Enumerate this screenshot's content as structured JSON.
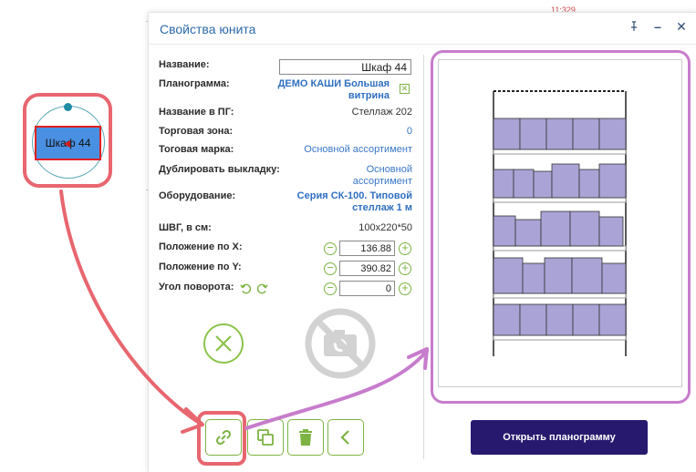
{
  "background": {
    "timestamp": "11:329"
  },
  "canvas_unit": {
    "label": "Шкаф 44"
  },
  "dialog": {
    "title": "Свойства юнита",
    "controls": {
      "pin": "pin-icon",
      "minimize": "–",
      "close": "✕"
    }
  },
  "properties": {
    "name": {
      "label": "Название:",
      "value": "Шкаф 44"
    },
    "planogram": {
      "label": "Планограмма:",
      "value_line1": "ДЕМО КАШИ Большая",
      "value_line2": "витрина"
    },
    "pg_name": {
      "label": "Название в ПГ:",
      "value": "Стеллаж 202"
    },
    "trade_zone": {
      "label": "Торговая зона:",
      "value": "0"
    },
    "brand": {
      "label": "Тоговая марка:",
      "value": "Основной ассортимент"
    },
    "duplicate": {
      "label": "Дублировать выкладку:",
      "value_line1": "Основной",
      "value_line2": "ассортимент"
    },
    "equipment": {
      "label": "Оборудование:",
      "value_line1": "Серия СК-100. Типовой",
      "value_line2": "стеллаж 1 м"
    },
    "dimensions": {
      "label": "ШВГ, в см:",
      "value": "100x220*50"
    },
    "pos_x": {
      "label": "Положение по X:",
      "value": "136.88"
    },
    "pos_y": {
      "label": "Положение по Y:",
      "value": "390.82"
    },
    "rotation": {
      "label": "Угол поворота:",
      "value": "0"
    }
  },
  "buttons": {
    "open_planogram": "Открыть планограмму"
  },
  "icons": {
    "cancel": "cancel-circle-icon",
    "no_photo": "no-photo-icon",
    "link": "link-icon",
    "copy": "copy-icon",
    "delete": "trash-icon",
    "back": "chevron-left-icon"
  },
  "colors": {
    "accent_green": "#7cb342",
    "link_blue": "#3a77c6",
    "title_blue": "#2d6aa8",
    "primary_button": "#271a6e",
    "highlight_red": "#e8666f",
    "highlight_purple": "#c77ccc",
    "shelf_fill": "#a9a3d6"
  }
}
